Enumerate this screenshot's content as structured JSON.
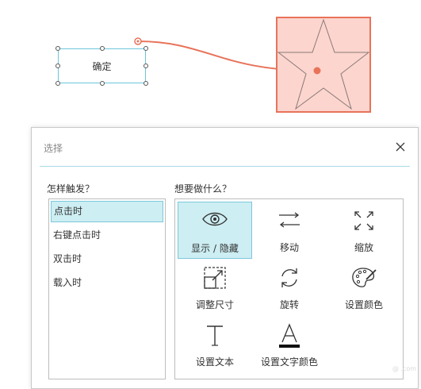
{
  "canvas": {
    "button_label": "确定"
  },
  "dialog": {
    "title": "选择",
    "trigger_heading": "怎样触发？",
    "action_heading": "想要做什么？",
    "triggers": [
      {
        "label": "点击时",
        "selected": true
      },
      {
        "label": "右键点击时",
        "selected": false
      },
      {
        "label": "双击时",
        "selected": false
      },
      {
        "label": "载入时",
        "selected": false
      }
    ],
    "actions": [
      {
        "label": "显示 / 隐藏",
        "icon": "eye-icon",
        "selected": true
      },
      {
        "label": "移动",
        "icon": "move-arrows-icon",
        "selected": false
      },
      {
        "label": "缩放",
        "icon": "expand-icon",
        "selected": false
      },
      {
        "label": "调整尺寸",
        "icon": "resize-icon",
        "selected": false
      },
      {
        "label": "旋转",
        "icon": "rotate-icon",
        "selected": false
      },
      {
        "label": "设置颜色",
        "icon": "palette-icon",
        "selected": false
      },
      {
        "label": "设置文本",
        "icon": "text-icon",
        "selected": false
      },
      {
        "label": "设置文字颜色",
        "icon": "text-color-icon",
        "selected": false
      }
    ]
  },
  "colors": {
    "accent": "#7cc8da",
    "selected_bg": "#cdeef3",
    "connector": "#e8735a",
    "star_fill": "#fcd5ce"
  },
  "watermark": "@ .com"
}
